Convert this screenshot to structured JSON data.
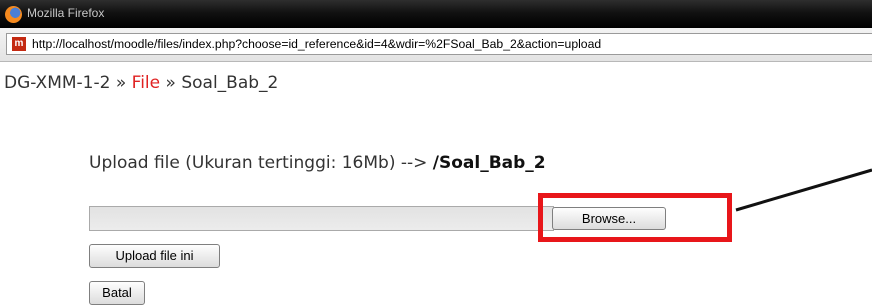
{
  "window": {
    "title": "Mozilla Firefox",
    "url": "http://localhost/moodle/files/index.php?choose=id_reference&id=4&wdir=%2FSoal_Bab_2&action=upload",
    "site_icon_text": "m"
  },
  "breadcrumb": {
    "items": [
      {
        "label": "DG-XMM-1-2"
      },
      {
        "label": "File"
      },
      {
        "label": "Soal_Bab_2"
      }
    ],
    "separator": " » "
  },
  "upload": {
    "heading": "Upload file (Ukuran tertinggi: 16Mb) -->",
    "directory": "/Soal_Bab_2",
    "file_value": "",
    "browse_label": "Browse...",
    "submit_label": "Upload file ini",
    "cancel_label": "Batal"
  },
  "annotation": {
    "color": "#e8161a"
  }
}
